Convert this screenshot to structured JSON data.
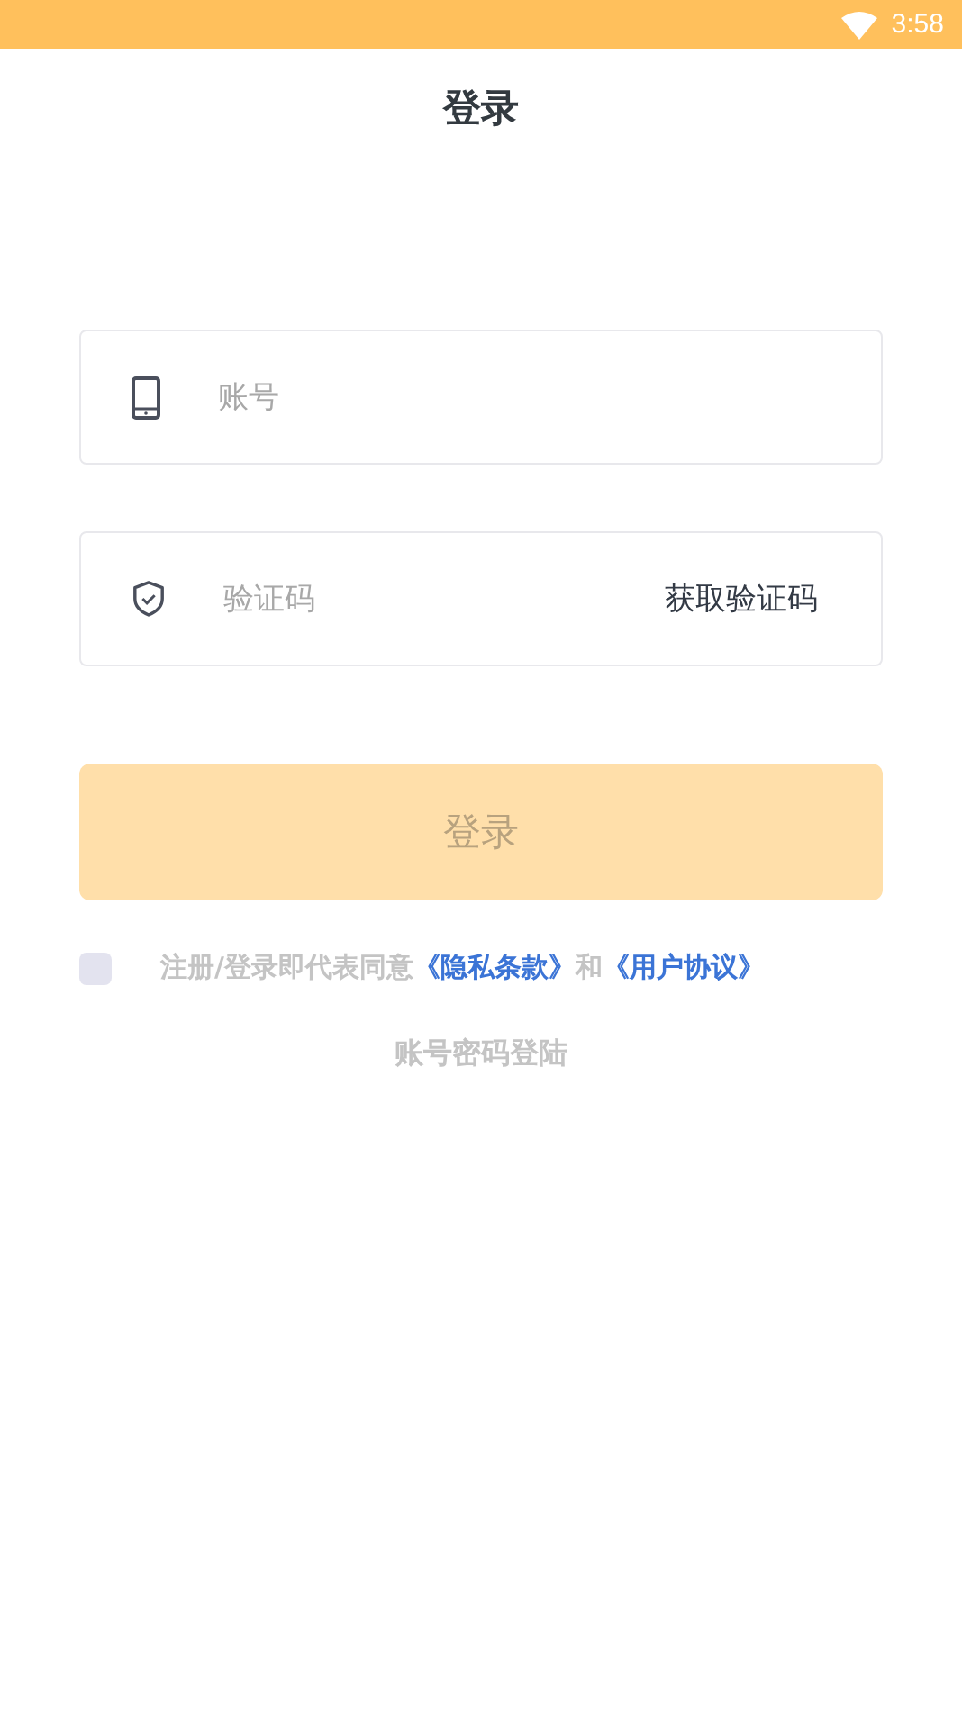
{
  "status_bar": {
    "time": "3:58"
  },
  "header": {
    "title": "登录"
  },
  "account_field": {
    "placeholder": "账号"
  },
  "code_field": {
    "placeholder": "验证码",
    "action": "获取验证码"
  },
  "login_button": {
    "label": "登录",
    "disabled": true
  },
  "agreement": {
    "checked": false,
    "parts": [
      {
        "kind": "text",
        "text": "注册/登录即代表同意"
      },
      {
        "kind": "link",
        "text": "《隐私条款》"
      },
      {
        "kind": "text",
        "text": "和"
      },
      {
        "kind": "link",
        "text": "《用户协议》"
      }
    ]
  },
  "password_login_link": "账号密码登陆"
}
